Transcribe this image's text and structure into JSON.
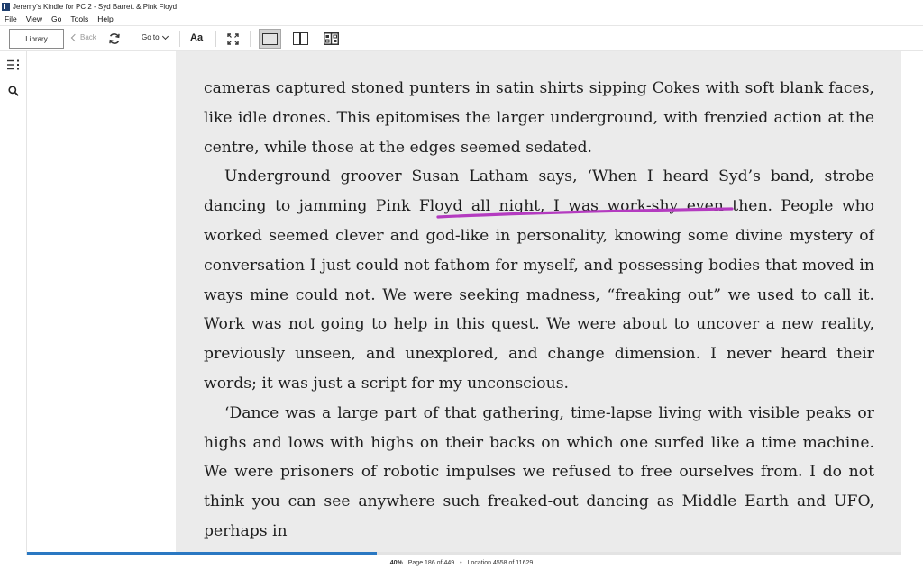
{
  "window": {
    "title": "Jeremy's Kindle for PC 2 - Syd Barrett & Pink Floyd"
  },
  "menu": [
    {
      "label": "File",
      "key": "F",
      "rest": "ile"
    },
    {
      "label": "View",
      "key": "V",
      "rest": "iew"
    },
    {
      "label": "Go",
      "key": "G",
      "rest": "o"
    },
    {
      "label": "Tools",
      "key": "T",
      "rest": "ools"
    },
    {
      "label": "Help",
      "key": "H",
      "rest": "elp"
    }
  ],
  "toolbar": {
    "library_label": "Library",
    "back_label": "Back",
    "goto_label": "Go to",
    "font_label": "Aa",
    "icons": [
      "sync-icon",
      "fullscreen-icon",
      "single-column-view-icon",
      "two-column-view-icon",
      "page-flip-view-icon"
    ]
  },
  "sidebar": {
    "icons": [
      "table-of-contents-icon",
      "search-icon"
    ]
  },
  "book": {
    "paragraphs": [
      {
        "indent": false,
        "text": "cameras captured stoned punters in satin shirts sipping Cokes with soft blank faces, like idle drones. This epitomises the larger underground, with frenzied action at the centre, while those at the edges seemed sedated."
      },
      {
        "indent": true,
        "text": "Underground groover Susan Latham says, ‘When I heard Syd’s band, strobe dancing to jamming Pink Floyd all night, I was work-shy even then. People who worked seemed clever and god-like in personality, knowing some divine mystery of conversation I just could not fathom for myself, and possessing bodies that moved in ways mine could not. We were seeking madness, “freaking out” we used to call it. Work was not going to help in this quest. We were about to uncover a new reality, previously unseen, and unexplored, and change dimension. I never heard their words; it was just a script for my unconscious."
      },
      {
        "indent": true,
        "text": "‘Dance was a large part of that gathering, time-lapse living with visible peaks or highs and lows with highs on their backs on which one surfed like a time machine. We were prisoners of robotic impulses we refused to free ourselves from. I do not think you can see anywhere such freaked-out dancing as Middle Earth and UFO, perhaps in"
      }
    ],
    "highlight_color": "#b43bc0"
  },
  "status": {
    "percent": "40%",
    "page": "Page 186 of 449",
    "location": "Location 4558 of 11629",
    "progress_fraction": 0.4,
    "separator": "•",
    "progress_color": "#2a78c2"
  }
}
